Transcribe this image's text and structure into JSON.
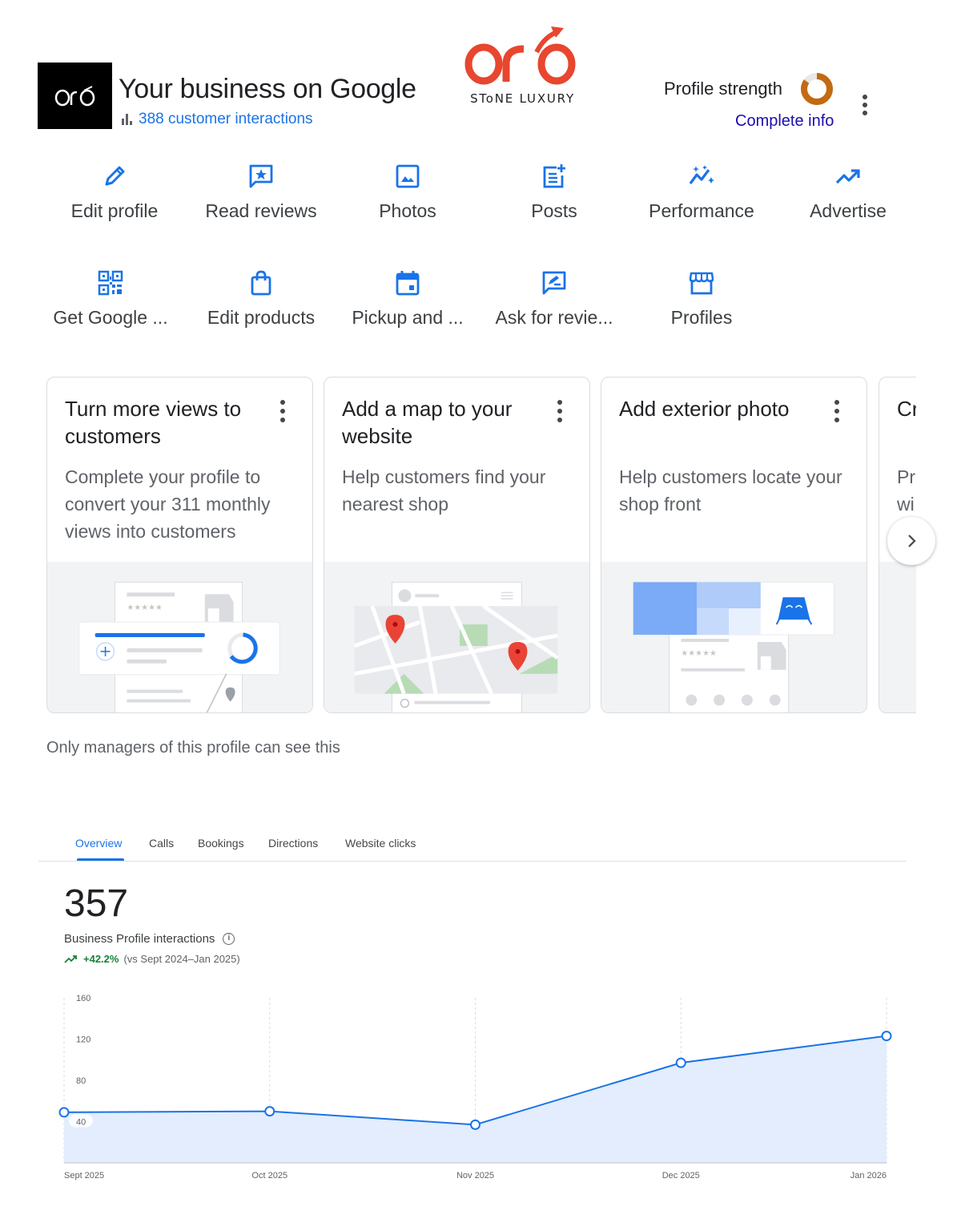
{
  "header": {
    "brand_thumb_icon": "oro-logo-icon",
    "title": "Your business on Google",
    "interactions_text": "388 customer interactions",
    "interactions_icon": "bar-chart-icon",
    "logo_brand": "STONE LUXURY",
    "logo_brand_display": "SToNE LUXURY",
    "profile_strength_label": "Profile strength",
    "profile_strength_level": 0.85,
    "complete_info_label": "Complete info",
    "accent_color": "#1a73e8",
    "logo_color": "#e8462f",
    "strength_color": "#c26a12"
  },
  "actions": [
    {
      "label": "Edit profile",
      "icon": "pencil-icon"
    },
    {
      "label": "Read reviews",
      "icon": "star-comment-icon"
    },
    {
      "label": "Photos",
      "icon": "image-icon"
    },
    {
      "label": "Posts",
      "icon": "post-add-icon"
    },
    {
      "label": "Performance",
      "icon": "sparkle-trend-icon"
    },
    {
      "label": "Advertise",
      "icon": "trending-up-icon"
    },
    {
      "label": "Get Google ...",
      "icon": "qr-code-icon"
    },
    {
      "label": "Edit products",
      "icon": "shopping-bag-icon"
    },
    {
      "label": "Pickup and ...",
      "icon": "calendar-icon"
    },
    {
      "label": "Ask for revie...",
      "icon": "rate-review-icon"
    },
    {
      "label": "Profiles",
      "icon": "storefront-icon"
    }
  ],
  "cards": [
    {
      "title": "Turn more views to customers",
      "description": "Complete your profile to convert your 311 monthly views into customers"
    },
    {
      "title": "Add a map to your website",
      "description": "Help customers find your nearest shop"
    },
    {
      "title": "Add exterior photo",
      "description": "Help customers locate your shop front"
    },
    {
      "title": "Cr",
      "description": "Pr wi"
    }
  ],
  "visibility_note": "Only managers of this profile can see this",
  "tabs": [
    {
      "label": "Overview",
      "active": true
    },
    {
      "label": "Calls",
      "active": false
    },
    {
      "label": "Bookings",
      "active": false
    },
    {
      "label": "Directions",
      "active": false
    },
    {
      "label": "Website clicks",
      "active": false
    }
  ],
  "metric": {
    "value": "357",
    "label": "Business Profile interactions",
    "change": "+42.2%",
    "comparison": "(vs Sept 2024–Jan 2025)"
  },
  "chart_data": {
    "type": "area",
    "x": [
      "Sept 2025",
      "Oct 2025",
      "Nov 2025",
      "Dec 2025",
      "Jan 2026"
    ],
    "series": [
      {
        "values": [
          49,
          50,
          37,
          97,
          123
        ]
      }
    ],
    "yticks": [
      160,
      120,
      80,
      40
    ],
    "ylim": [
      0,
      160
    ],
    "grid": "vertical-dashed",
    "line_color": "#1a73e8",
    "fill_color": "#e3edfd"
  }
}
